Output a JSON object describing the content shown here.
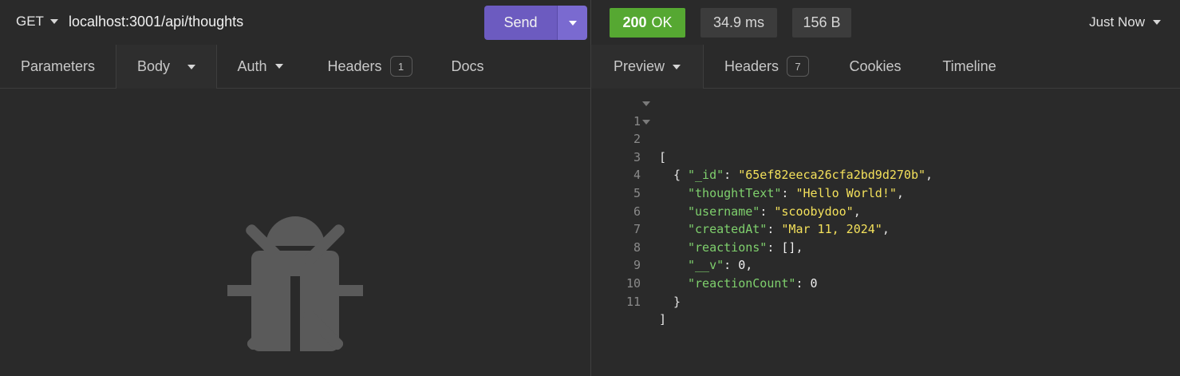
{
  "request": {
    "method": "GET",
    "url": "localhost:3001/api/thoughts",
    "send_label": "Send",
    "tabs": [
      {
        "label": "Parameters"
      },
      {
        "label": "Body"
      },
      {
        "label": "Auth"
      },
      {
        "label": "Headers",
        "badge": "1"
      },
      {
        "label": "Docs"
      }
    ]
  },
  "response": {
    "status_code": "200",
    "status_text": "OK",
    "time": "34.9 ms",
    "size": "156 B",
    "history": "Just Now",
    "tabs": [
      {
        "label": "Preview"
      },
      {
        "label": "Headers",
        "badge": "7"
      },
      {
        "label": "Cookies"
      },
      {
        "label": "Timeline"
      }
    ],
    "line_numbers": [
      "1",
      "2",
      "3",
      "4",
      "5",
      "6",
      "7",
      "8",
      "9",
      "10",
      "11"
    ],
    "json": {
      "open_bracket": "[",
      "open_brace": "{",
      "fields": [
        {
          "key": "\"_id\"",
          "value": "\"65ef82eeca26cfa2bd9d270b\"",
          "suffix": ","
        },
        {
          "key": "\"thoughtText\"",
          "value": "\"Hello World!\"",
          "suffix": ","
        },
        {
          "key": "\"username\"",
          "value": "\"scoobydoo\"",
          "suffix": ","
        },
        {
          "key": "\"createdAt\"",
          "value": "\"Mar 11, 2024\"",
          "suffix": ","
        },
        {
          "key": "\"reactions\"",
          "value": "[]",
          "suffix": ","
        },
        {
          "key": "\"__v\"",
          "value": "0",
          "suffix": ","
        },
        {
          "key": "\"reactionCount\"",
          "value": "0",
          "suffix": ""
        }
      ],
      "close_brace": "}",
      "close_bracket": "]"
    }
  },
  "colors": {
    "send": "#6c5bc0",
    "status_ok": "#56a832",
    "json_key": "#7fd06d",
    "json_string": "#f3e05b"
  },
  "icons": [
    "caret-down-icon",
    "bug-icon"
  ]
}
